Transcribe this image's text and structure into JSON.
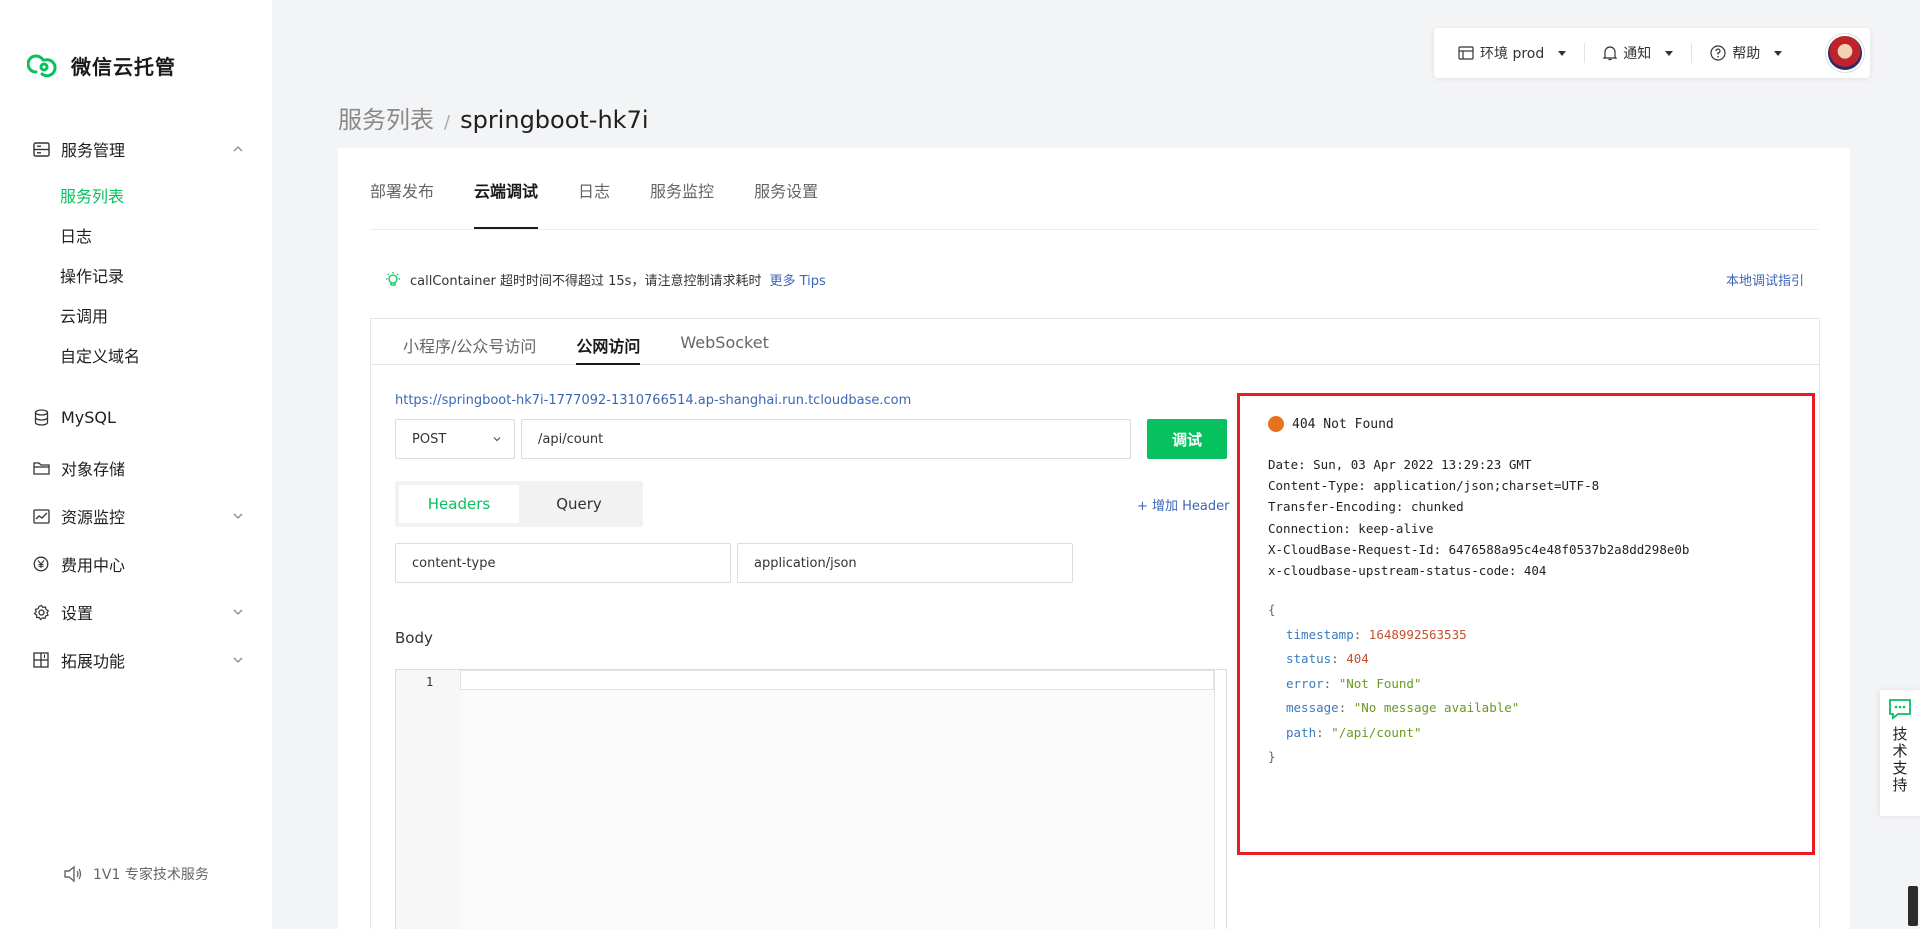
{
  "brand": {
    "name": "微信云托管",
    "color": "#07c160"
  },
  "sidebar": {
    "groups": [
      {
        "label": "服务管理",
        "icon": "server-icon"
      },
      {
        "label": "MySQL",
        "icon": "database-icon"
      },
      {
        "label": "对象存储",
        "icon": "folder-icon"
      },
      {
        "label": "资源监控",
        "icon": "monitor-chart-icon"
      },
      {
        "label": "费用中心",
        "icon": "yen-icon"
      },
      {
        "label": "设置",
        "icon": "gear-icon"
      },
      {
        "label": "拓展功能",
        "icon": "grid-plus-icon"
      }
    ],
    "service_items": [
      "服务列表",
      "日志",
      "操作记录",
      "云调用",
      "自定义域名"
    ],
    "expert_service": "1V1 专家技术服务"
  },
  "topbar": {
    "env_label": "环境 prod",
    "notify_label": "通知",
    "help_label": "帮助"
  },
  "breadcrumb": {
    "parent": "服务列表",
    "separator": "/",
    "current": "springboot-hk7i"
  },
  "tabs": [
    "部署发布",
    "云端调试",
    "日志",
    "服务监控",
    "服务设置"
  ],
  "active_tab": "云端调试",
  "tip": {
    "text": "callContainer 超时时间不得超过 15s，请注意控制请求耗时",
    "link": "更多 Tips",
    "local_guide": "本地调试指引"
  },
  "subtabs": [
    "小程序/公众号访问",
    "公网访问",
    "WebSocket"
  ],
  "active_subtab": "公网访问",
  "request": {
    "url": "https://springboot-hk7i-1777092-1310766514.ap-shanghai.run.tcloudbase.com",
    "method": "POST",
    "path": "/api/count",
    "debug_button": "调试",
    "segments": [
      "Headers",
      "Query"
    ],
    "add_header": "+ 增加 Header",
    "header_key": "content-type",
    "header_value": "application/json",
    "body_label": "Body",
    "line_number": "1"
  },
  "response": {
    "status": "404 Not Found",
    "status_color": "#e8711c",
    "headers": [
      "Date: Sun, 03 Apr 2022 13:29:23 GMT",
      "Content-Type: application/json;charset=UTF-8",
      "Transfer-Encoding: chunked",
      "Connection: keep-alive",
      "X-CloudBase-Request-Id: 6476588a95c4e48f0537b2a8dd298e0b",
      "x-cloudbase-upstream-status-code: 404"
    ],
    "json_open": "{",
    "json_close": "}",
    "json_fields": [
      {
        "key": "timestamp",
        "value": "1648992563535"
      },
      {
        "key": "status",
        "value": "404"
      },
      {
        "key": "error",
        "value": "\"Not Found\""
      },
      {
        "key": "message",
        "value": "\"No message available\""
      },
      {
        "key": "path",
        "value": "\"/api/count\""
      }
    ]
  },
  "support": {
    "label": "技术支持"
  }
}
